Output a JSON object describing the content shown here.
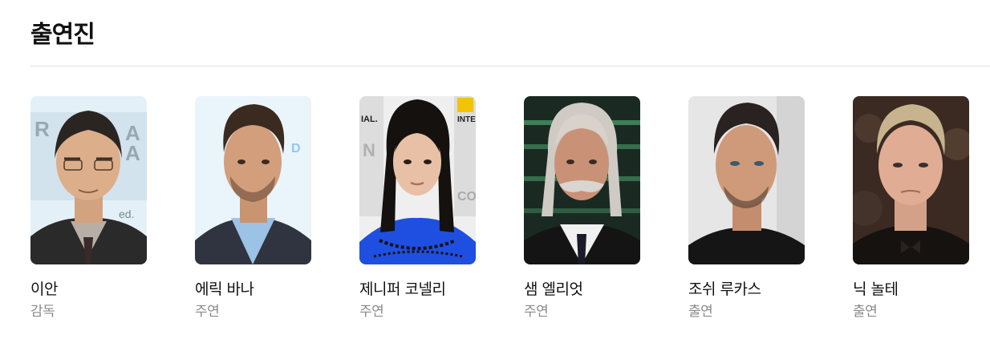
{
  "section": {
    "title": "출연진"
  },
  "cast": [
    {
      "name": "이안",
      "role": "감독"
    },
    {
      "name": "에릭 바나",
      "role": "주연"
    },
    {
      "name": "제니퍼 코넬리",
      "role": "주연"
    },
    {
      "name": "샘 엘리엇",
      "role": "주연"
    },
    {
      "name": "조쉬 루카스",
      "role": "출연"
    },
    {
      "name": "닉 놀테",
      "role": "출연"
    }
  ]
}
